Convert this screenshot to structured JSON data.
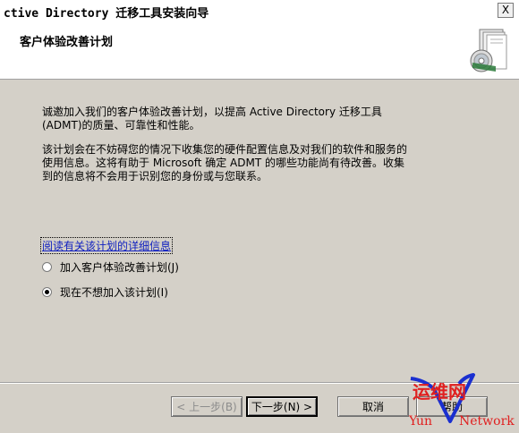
{
  "window": {
    "title": "ctive Directory 迁移工具安装向导",
    "close_symbol": "X"
  },
  "header": {
    "title": "客户体验改善计划",
    "graphic_icon": "installer-box-cd-icon"
  },
  "body": {
    "paragraph1_line1": "诚邀加入我们的客户体验改善计划，以提高 Active Directory 迁移工具",
    "paragraph1_line2": "(ADMT)的质量、可靠性和性能。",
    "paragraph2_line1": "该计划会在不妨碍您的情况下收集您的硬件配置信息及对我们的软件和服务的",
    "paragraph2_line2": "使用信息。这将有助于 Microsoft 确定 ADMT 的哪些功能尚有待改善。收集",
    "paragraph2_line3": "到的信息将不会用于识别您的身份或与您联系。",
    "more_info_link": "阅读有关该计划的详细信息",
    "option_join": "加入客户体验改善计划(J)",
    "option_decline": "现在不想加入该计划(I)",
    "selected_option": "decline"
  },
  "buttons": {
    "back": "< 上一步(B)",
    "next": "下一步(N) >",
    "cancel": "取消",
    "help": "帮助"
  },
  "watermark": {
    "cn": "运维网",
    "en_left": "Yun",
    "en_right": "Network",
    "color": "#e02020",
    "v_color": "#1a2fd0"
  }
}
